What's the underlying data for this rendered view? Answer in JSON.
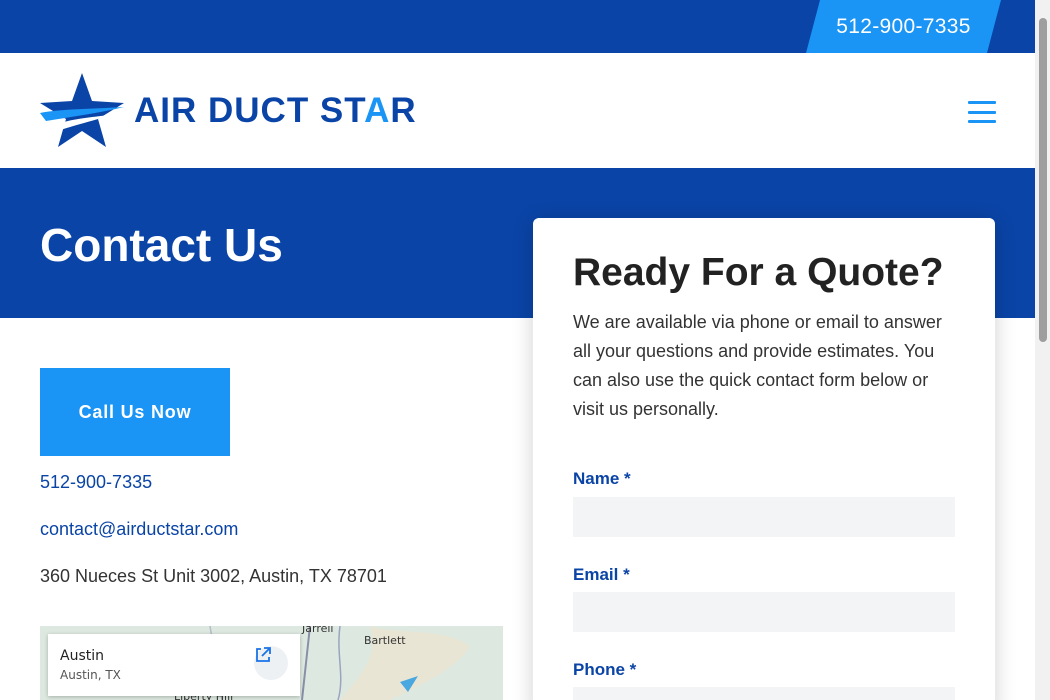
{
  "topbar": {
    "phone": "512-900-7335"
  },
  "header": {
    "logo_text_part1": "AIR DUCT ST",
    "logo_text_accent": "A",
    "logo_text_part2": "R",
    "menu_icon": "hamburger-icon"
  },
  "hero": {
    "title": "Contact Us"
  },
  "contact": {
    "call_button": "Call Us Now",
    "phone": "512-900-7335",
    "email": "contact@airductstar.com",
    "address": "360 Nueces St Unit 3002, Austin, TX 78701"
  },
  "map": {
    "place_title": "Austin",
    "place_subtitle": "Austin, TX",
    "open_icon": "external-link-icon",
    "labels": [
      "Jarrell",
      "Bartlett",
      "Liberty Hill"
    ]
  },
  "quote_form": {
    "title": "Ready For a Quote?",
    "description": "We are available via phone or email to answer all your questions and provide estimates. You can also use the quick contact form below or visit us personally.",
    "fields": [
      {
        "label": "Name *",
        "value": ""
      },
      {
        "label": "Email *",
        "value": ""
      },
      {
        "label": "Phone *",
        "value": ""
      }
    ]
  },
  "colors": {
    "brand_dark": "#0a44a6",
    "brand_light": "#1a94f5"
  }
}
